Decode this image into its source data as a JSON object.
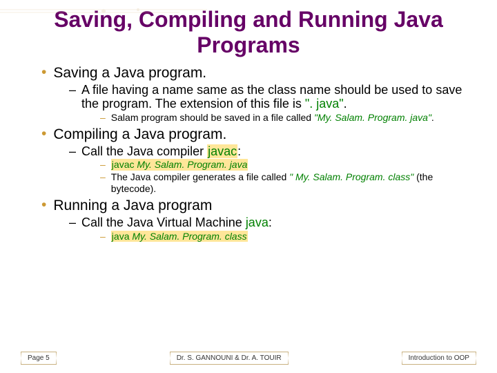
{
  "title": "Saving, Compiling and Running Java Programs",
  "sections": [
    {
      "heading": "Saving a Java program.",
      "sub": [
        {
          "text_pre": "A file having a name same as the class name should be used to save the program. The extension of this file is ",
          "text_green": "\". java\"",
          "text_post": ".",
          "subsub": [
            {
              "pre": "Salam program should be saved in a file called ",
              "file_hl": "\"My. Salam. Program. java\"",
              "post": "."
            }
          ]
        }
      ]
    },
    {
      "heading": "Compiling a Java program.",
      "sub": [
        {
          "text_pre": "Call the Java compiler ",
          "text_green": "javac",
          "text_post": ":",
          "subsub": [
            {
              "cmd_word": "javac ",
              "cmd_file": "My. Salam. Program. java"
            },
            {
              "plain_pre": "The Java compiler generates a file called ",
              "plain_green": "\" My. Salam. Program. class\"",
              "plain_post": " (the bytecode)."
            }
          ]
        }
      ]
    },
    {
      "heading": "Running a Java program",
      "sub": [
        {
          "text_pre": "Call the Java Virtual Machine ",
          "text_green": "java",
          "text_post": ":",
          "subsub": [
            {
              "cmd_word": "java ",
              "cmd_file": "My. Salam. Program. class"
            }
          ]
        }
      ]
    }
  ],
  "footer": {
    "left": "Page 5",
    "center": "Dr. S. GANNOUNI & Dr. A. TOUIR",
    "right": "Introduction to OOP"
  }
}
